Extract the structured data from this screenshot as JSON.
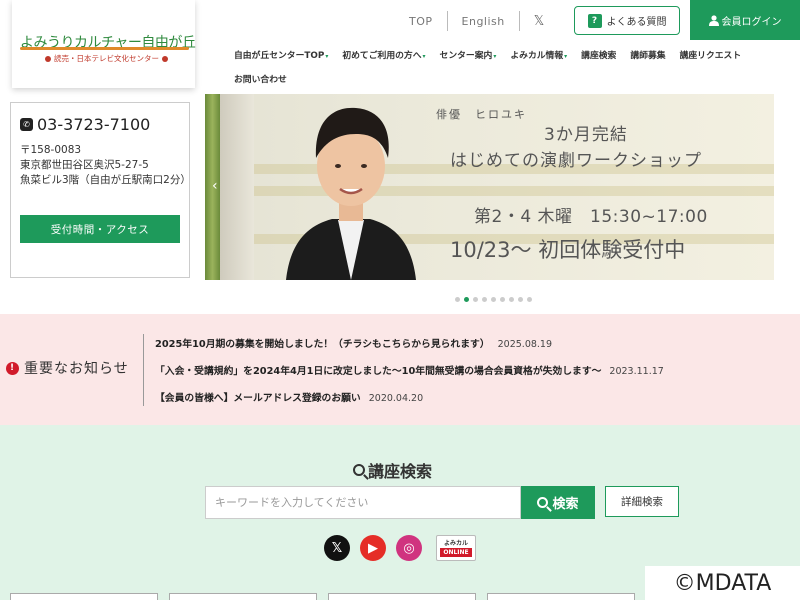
{
  "logo": {
    "name": "よみうりカルチャー自由が丘",
    "sub": "読売・日本テレビ文化センター"
  },
  "util": {
    "top": "TOP",
    "english": "English",
    "x_icon": "𝕏"
  },
  "faq": {
    "label": "よくある質問",
    "icon": "?"
  },
  "login": {
    "label": "会員ログイン",
    "icon": "user-icon"
  },
  "nav": {
    "row1": [
      {
        "label": "自由が丘センターTOP",
        "dropdown": true
      },
      {
        "label": "初めてご利用の方へ",
        "dropdown": true
      },
      {
        "label": "センター案内",
        "dropdown": true
      },
      {
        "label": "よみカル情報",
        "dropdown": true
      },
      {
        "label": "講座検索",
        "dropdown": false
      },
      {
        "label": "講師募集",
        "dropdown": false
      },
      {
        "label": "講座リクエスト",
        "dropdown": false
      }
    ],
    "row2": [
      {
        "label": "お問い合わせ",
        "dropdown": false
      }
    ]
  },
  "contact": {
    "phone": "03-3723-7100",
    "postal": "〒158-0083",
    "address": "東京都世田谷区奥沢5-27-5",
    "building": "魚菜ビル3階（自由が丘駅南口2分）",
    "access_button": "受付時間・アクセス"
  },
  "hero": {
    "role": "俳優　ヒロユキ",
    "title1": "3か月完結",
    "title2": "はじめての演劇ワークショップ",
    "schedule": "第2・4 木曜　15:30~17:00",
    "trial": "10/23～ 初回体験受付中",
    "slide_count": 9,
    "active_slide": 2
  },
  "notices": {
    "heading": "重要なお知らせ",
    "items": [
      {
        "text": "2025年10月期の募集を開始しました！（チラシもこちらから見られます）",
        "date": "2025.08.19"
      },
      {
        "text": "「入会・受講規約」を2024年4月1日に改定しました〜10年間無受講の場合会員資格が失効します〜",
        "date": "2023.11.17"
      },
      {
        "text": "【会員の皆様へ】メールアドレス登録のお願い",
        "date": "2020.04.20"
      }
    ]
  },
  "search": {
    "title": "講座検索",
    "placeholder": "キーワードを入力してください",
    "button": "検索",
    "detail_button": "詳細検索"
  },
  "social": {
    "x": "𝕏",
    "youtube": "▶",
    "instagram": "◎",
    "yomikaru_top": "よみカル",
    "yomikaru_bottom": "ONLINE"
  },
  "watermark": "©MDATA",
  "colors": {
    "accent": "#1e9a5b",
    "notice_bg": "#fbe7e7",
    "search_bg": "#e0f3e7",
    "alert": "#d11a2a"
  }
}
